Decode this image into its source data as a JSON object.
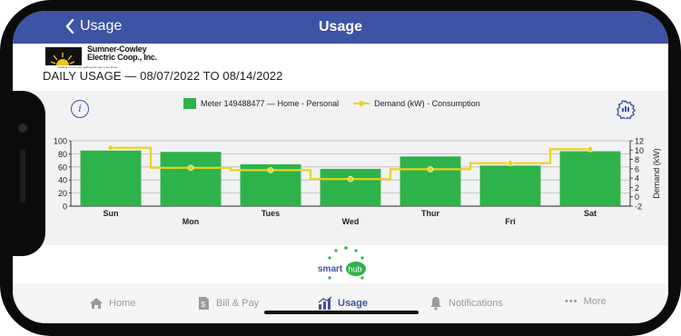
{
  "navbar": {
    "back_label": "Usage",
    "title": "Usage"
  },
  "logo": {
    "line1": "Sumner-Cowley",
    "line2": "Electric Coop., Inc.",
    "tagline": "building on our past, lighting the way to the future"
  },
  "usage_title": "DAILY USAGE — 08/07/2022 TO 08/14/2022",
  "legend": {
    "meter": "Meter 149488477 — Home - Personal",
    "demand": "Demand (kW) - Consumption"
  },
  "colors": {
    "bar": "#2db34a",
    "demand": "#e8d51a",
    "brand": "#3d53a3"
  },
  "chart_data": {
    "type": "bar",
    "categories": [
      "Sun",
      "Mon",
      "Tues",
      "Wed",
      "Thur",
      "Fri",
      "Sat"
    ],
    "series": [
      {
        "name": "Meter 149488477 — Home - Personal",
        "type": "bar",
        "axis": "left",
        "values": [
          85,
          83,
          64,
          57,
          76,
          62,
          84
        ]
      },
      {
        "name": "Demand (kW) - Consumption",
        "type": "step-line",
        "axis": "right",
        "values": [
          10.5,
          6.2,
          5.7,
          3.8,
          5.9,
          7.2,
          10.2
        ]
      }
    ],
    "y_left": {
      "min": 0,
      "max": 100,
      "ticks": [
        "0",
        "20",
        "40",
        "60",
        "80",
        "100"
      ]
    },
    "y_right": {
      "min": -2,
      "max": 12,
      "label": "Demand (kW)",
      "ticks": [
        "-2",
        "0",
        "2",
        "4",
        "6",
        "8",
        "10",
        "12"
      ]
    },
    "grid": true
  },
  "smarthub": {
    "left": "smart",
    "right": "hub"
  },
  "tabs": [
    {
      "label": "Home",
      "icon": "home-icon"
    },
    {
      "label": "Bill & Pay",
      "icon": "bill-icon"
    },
    {
      "label": "Usage",
      "icon": "usage-chart-icon"
    },
    {
      "label": "Notifications",
      "icon": "bell-icon"
    },
    {
      "label": "More",
      "icon": "more-icon"
    }
  ]
}
